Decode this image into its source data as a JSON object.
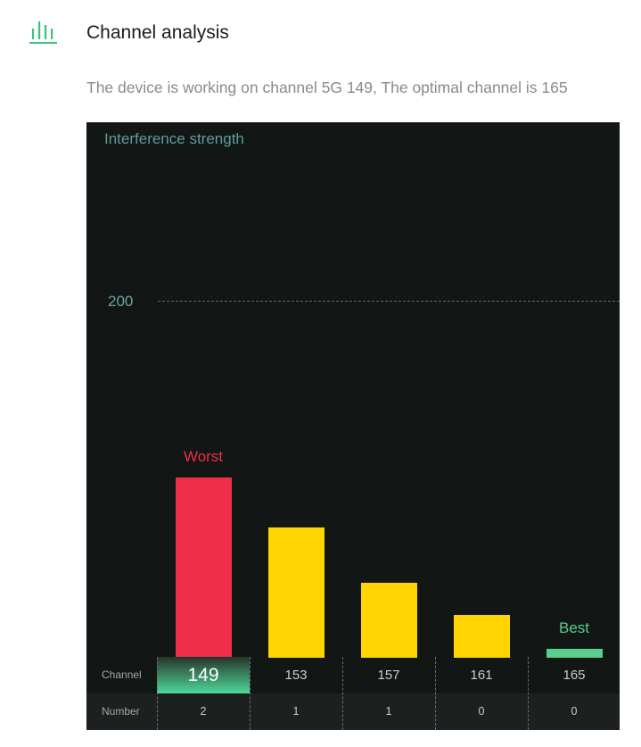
{
  "header": {
    "title": "Channel analysis",
    "icon": "signal-bars-icon"
  },
  "status": {
    "text": "The device is working on channel 5G 149, The optimal channel is 165"
  },
  "colors": {
    "accent": "#3fbf7f",
    "worst": "#ee2e4a",
    "normal": "#ffd400",
    "best": "#58cf8c",
    "panel": "#121614"
  },
  "chart_data": {
    "type": "bar",
    "title": "",
    "ylabel": "Interference strength",
    "xlabel": "Channel",
    "yticks": [
      200
    ],
    "ylim": [
      0,
      320
    ],
    "grid": "dashed horizontal",
    "categories": [
      "149",
      "153",
      "157",
      "161",
      "165"
    ],
    "values": [
      101,
      73,
      42,
      24,
      5
    ],
    "counts": [
      "2",
      "1",
      "1",
      "0",
      "0"
    ],
    "selected": "149",
    "annotations": [
      {
        "category": "149",
        "text": "Worst",
        "color": "#ee2e4a"
      },
      {
        "category": "165",
        "text": "Best",
        "color": "#58cf8c"
      }
    ],
    "row_labels": {
      "channel": "Channel",
      "number": "Number"
    }
  }
}
